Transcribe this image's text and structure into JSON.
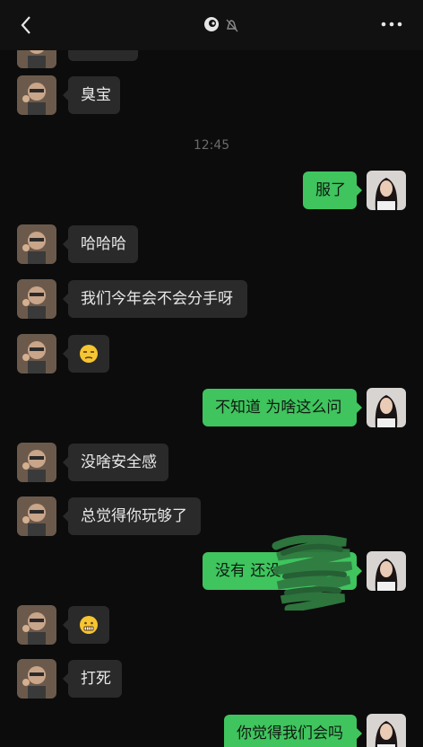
{
  "header": {
    "back_icon": "chevron-left-icon",
    "title_icons": [
      "swirl-icon",
      "muted-bell-icon"
    ],
    "more_icon": "more-dots-icon"
  },
  "timestamp": "12:45",
  "messages": [
    {
      "side": "in",
      "text": "臭宝"
    },
    {
      "side": "out",
      "text": "服了"
    },
    {
      "side": "in",
      "text": "哈哈哈"
    },
    {
      "side": "in",
      "text": "我们今年会不会分手呀"
    },
    {
      "side": "in",
      "text": "",
      "emoji": "unamused-face-emoji"
    },
    {
      "side": "out",
      "text": "不知道 为啥这么问"
    },
    {
      "side": "in",
      "text": "没啥安全感"
    },
    {
      "side": "in",
      "text": "总觉得你玩够了"
    },
    {
      "side": "out",
      "text": "没有 还没"
    },
    {
      "side": "in",
      "text": "",
      "emoji": "grimacing-face-emoji"
    },
    {
      "side": "in",
      "text": "打死"
    },
    {
      "side": "out",
      "text": "你觉得我们会吗"
    }
  ],
  "colors": {
    "background": "#0c0c0c",
    "incoming_bubble": "#2a2a2a",
    "outgoing_bubble": "#3fc45e",
    "timestamp": "#6a6a6a"
  }
}
